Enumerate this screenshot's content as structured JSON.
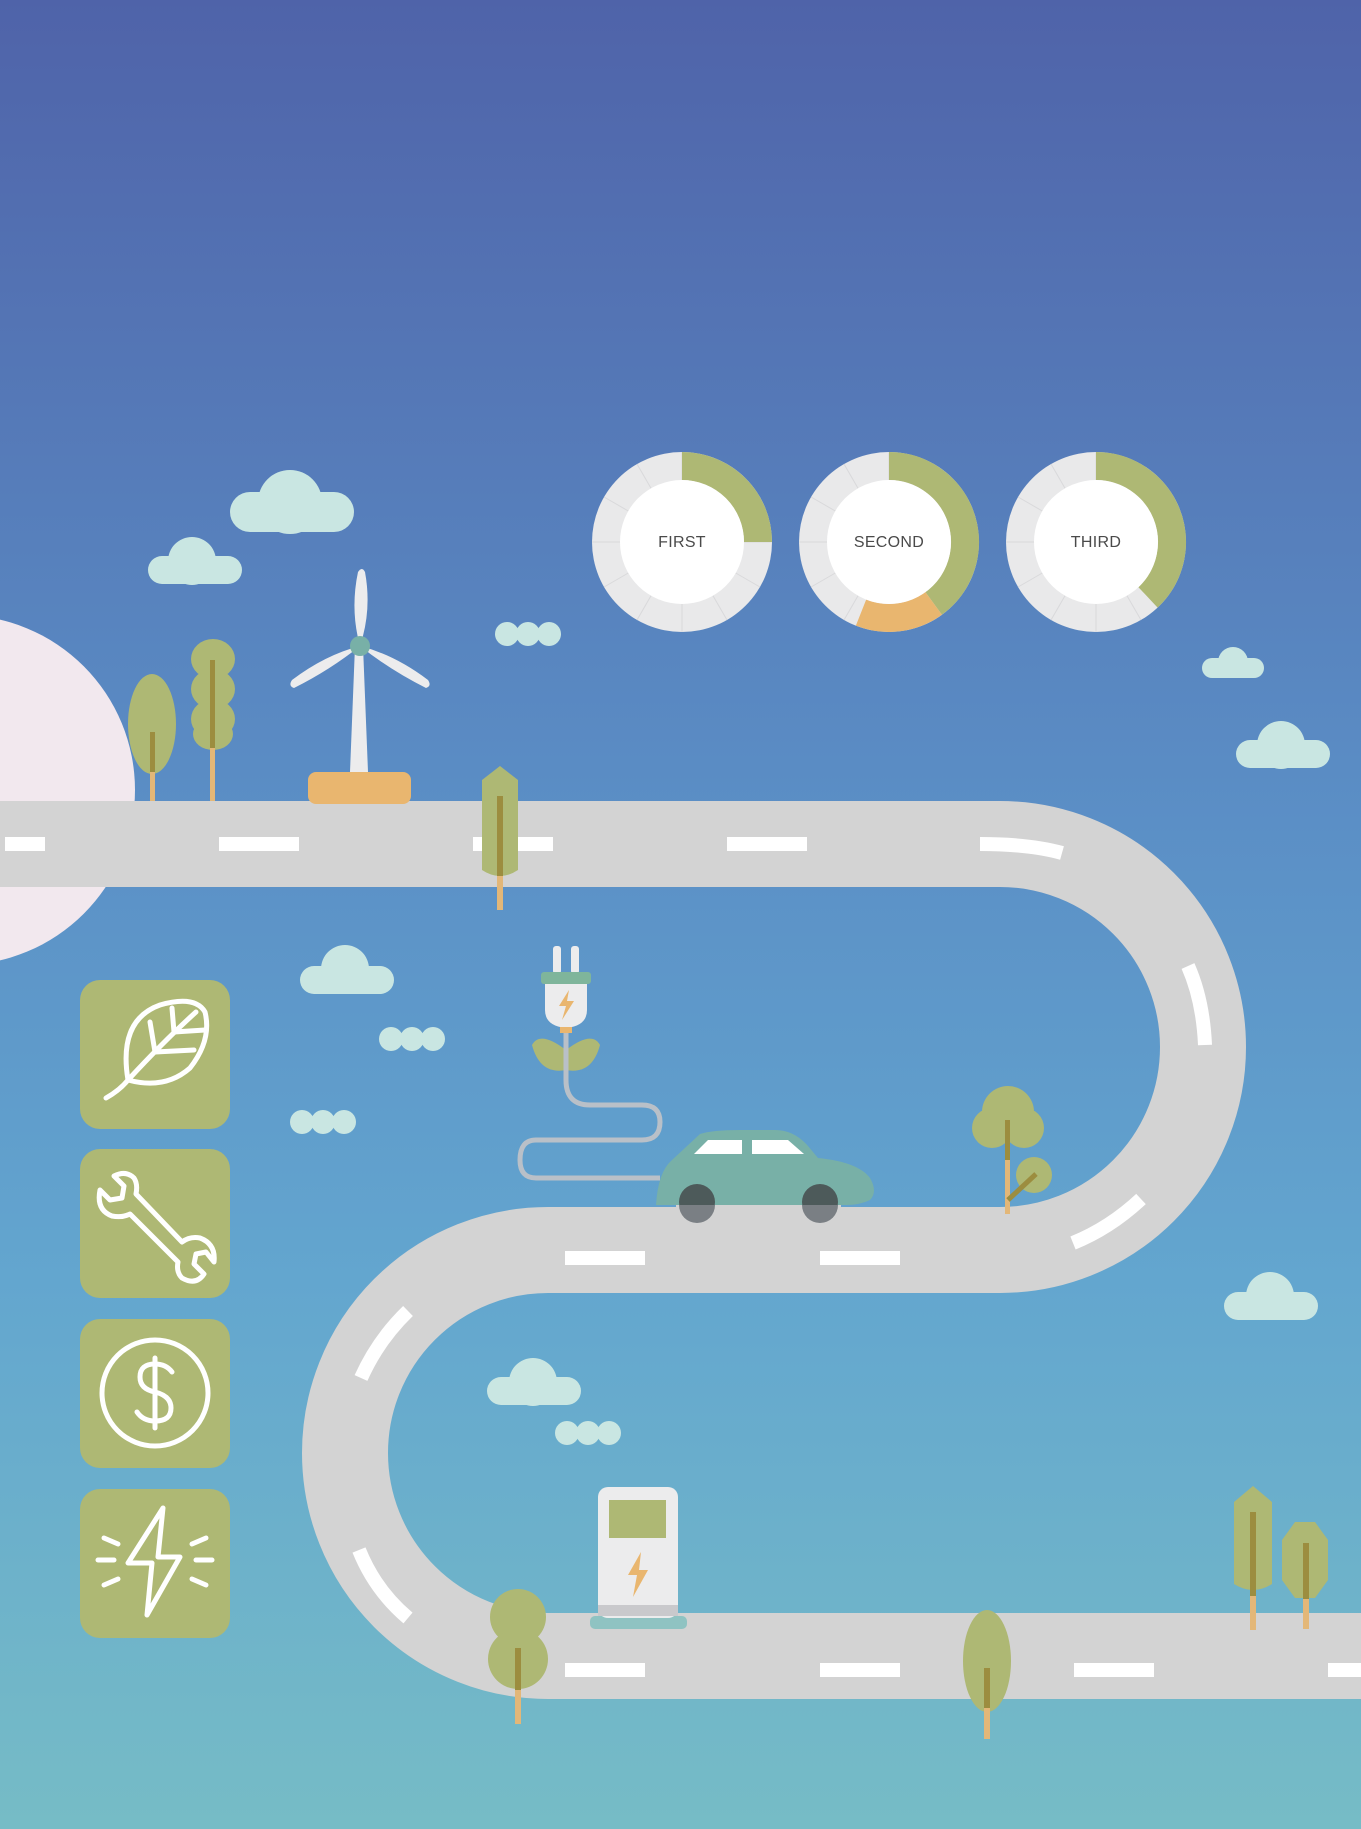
{
  "colors": {
    "sky_top": "#4f63a9",
    "sky_bottom": "#76bcc6",
    "road": "#d3d3d3",
    "road_dash": "#ffffff",
    "tree_green": "#aeb874",
    "trunk": "#e3b778",
    "trunk_dark": "#9c8d3f",
    "cloud": "#c9e6e2",
    "car": "#78b0a7",
    "tile_green": "#aeb874",
    "sun_pink": "#f2e8ee",
    "accent_orange": "#e9b66f",
    "ring_track": "#e9e9ea"
  },
  "progress_rings": [
    {
      "label": "FIRST",
      "green_fraction": 0.25,
      "orange_fraction": 0.0
    },
    {
      "label": "SECOND",
      "green_fraction": 0.4,
      "orange_fraction": 0.16
    },
    {
      "label": "THIRD",
      "green_fraction": 0.38,
      "orange_fraction": 0.0
    }
  ],
  "feature_tiles": [
    {
      "icon": "leaf-icon"
    },
    {
      "icon": "wrench-icon"
    },
    {
      "icon": "dollar-icon"
    },
    {
      "icon": "lightning-icon"
    }
  ]
}
